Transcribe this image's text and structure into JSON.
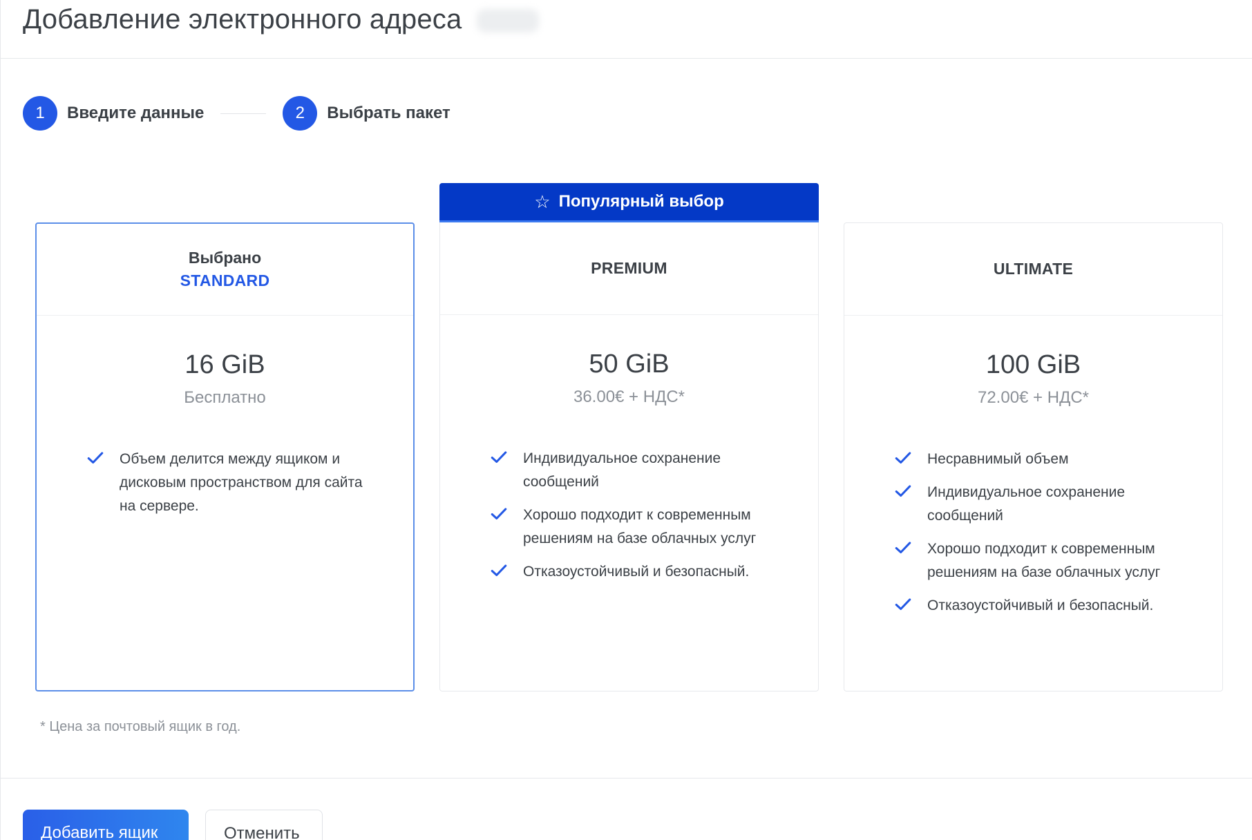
{
  "header": {
    "title": "Добавление электронного адреса"
  },
  "stepper": {
    "steps": [
      {
        "number": "1",
        "label": "Введите данные"
      },
      {
        "number": "2",
        "label": "Выбрать пакет"
      }
    ]
  },
  "plans": {
    "popular_label": "Популярный выбор",
    "selected_caption": "Выбрано",
    "items": [
      {
        "name": "STANDARD",
        "size": "16 GiB",
        "price": "Бесплатно",
        "selected": true,
        "features": [
          "Объем делится между ящиком и дисковым пространством для сайта на сервере."
        ]
      },
      {
        "name": "PREMIUM",
        "size": "50 GiB",
        "price": "36.00€ + НДС*",
        "popular": true,
        "features": [
          "Индивидуальное сохранение сообщений",
          "Хорошо подходит к современным решениям на базе облачных услуг",
          "Отказоустойчивый и безопасный."
        ]
      },
      {
        "name": "ULTIMATE",
        "size": "100 GiB",
        "price": "72.00€ + НДС*",
        "features": [
          "Несравнимый объем",
          "Индивидуальное сохранение сообщений",
          "Хорошо подходит к современным решениям на базе облачных услуг",
          "Отказоустойчивый и безопасный."
        ]
      }
    ]
  },
  "footnote": "* Цена за почтовый ящик в год.",
  "footer": {
    "primary_label": "Добавить ящик",
    "secondary_label": "Отменить"
  },
  "colors": {
    "accent": "#2358e5",
    "popular_banner": "#0439c6",
    "check": "#2358e5"
  },
  "icons": {
    "popular": "star-outline-icon",
    "feature": "check-icon"
  }
}
